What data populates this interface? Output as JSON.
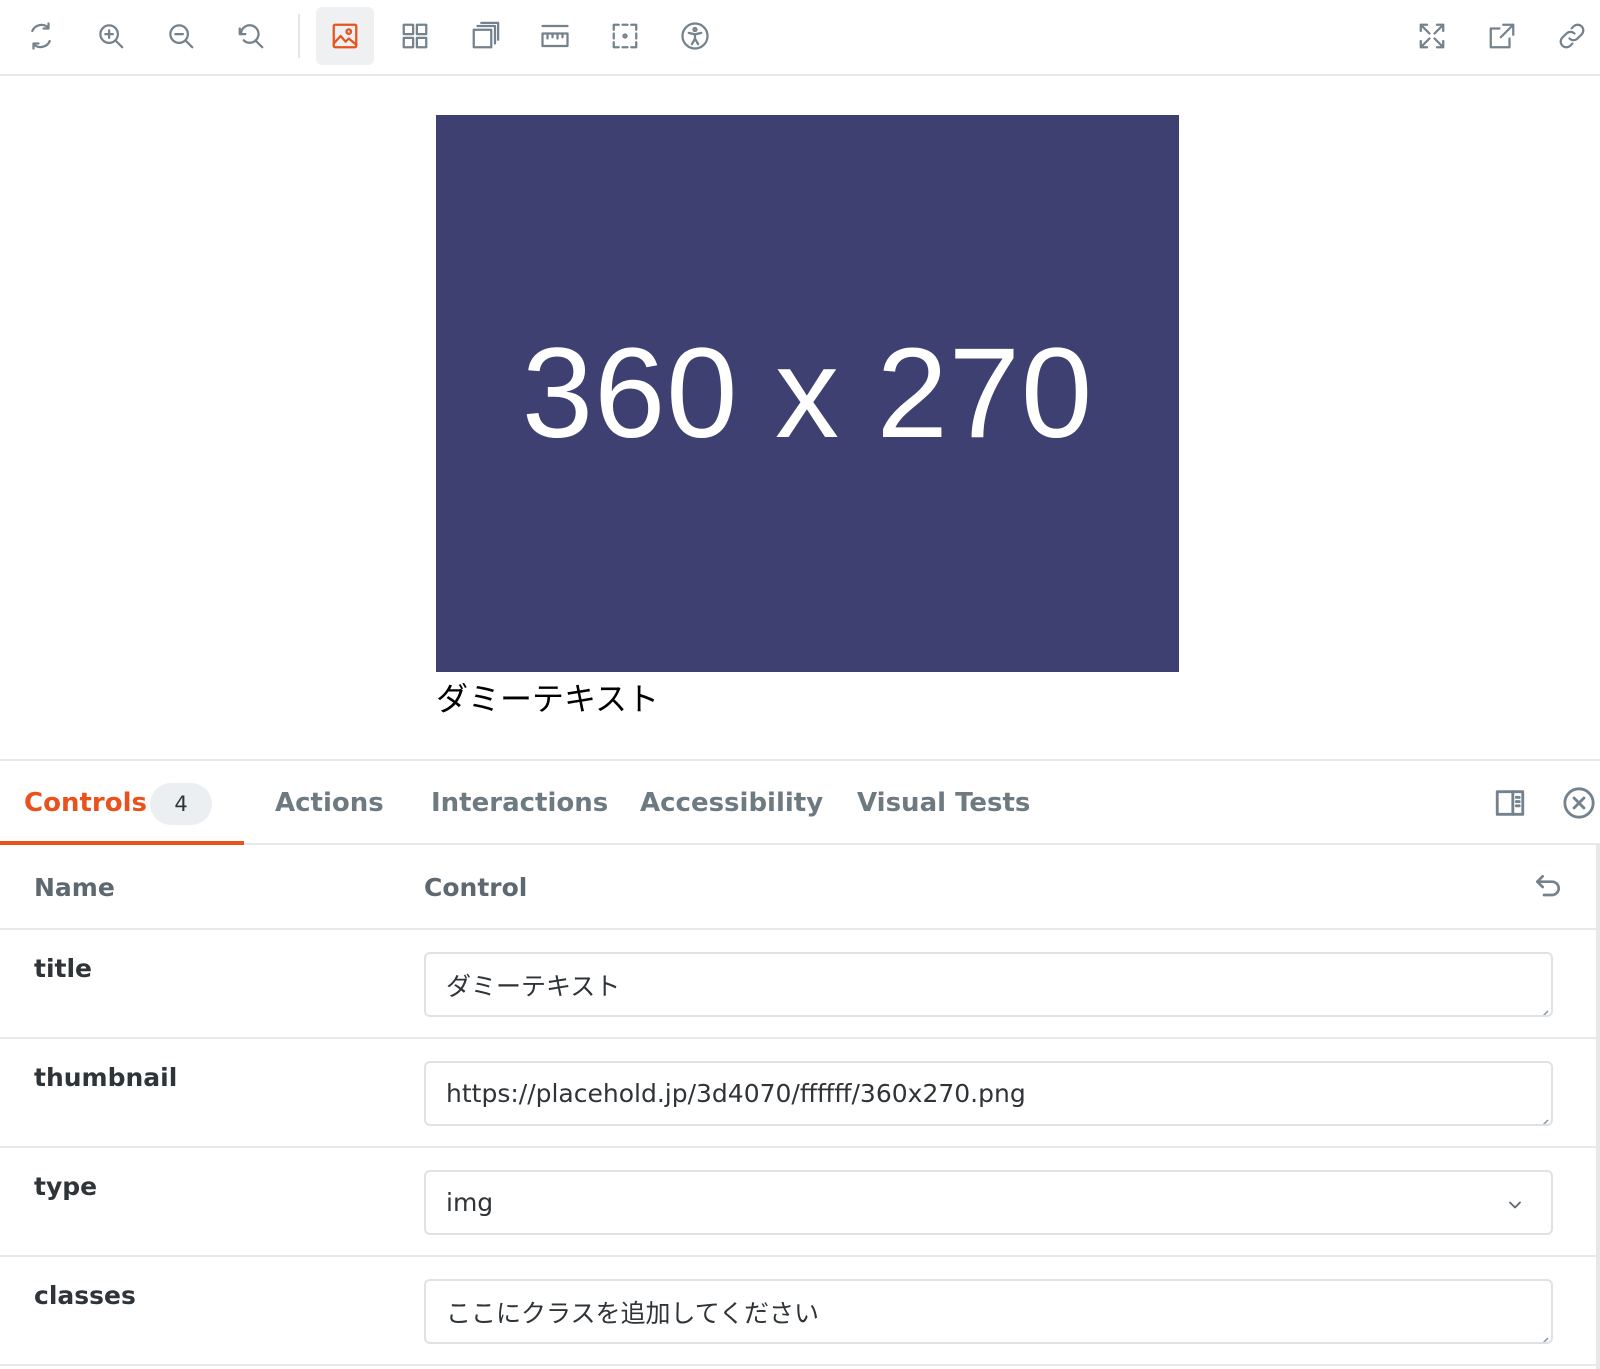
{
  "toolbar": {
    "active_tool": "background-image-icon"
  },
  "preview": {
    "thumbnail_bg": "#3d4070",
    "thumbnail_fg": "#ffffff",
    "thumbnail_text": "360 x 270",
    "caption": "ダミーテキスト"
  },
  "panel": {
    "accent": "#e9521d",
    "tabs": [
      {
        "label": "Controls",
        "badge": "4"
      },
      {
        "label": "Actions"
      },
      {
        "label": "Interactions"
      },
      {
        "label": "Accessibility"
      },
      {
        "label": "Visual Tests"
      }
    ],
    "table": {
      "header_name": "Name",
      "header_control": "Control",
      "rows": [
        {
          "name": "title",
          "value": "ダミーテキスト",
          "control": "textarea"
        },
        {
          "name": "thumbnail",
          "value": "https://placehold.jp/3d4070/ffffff/360x270.png",
          "control": "textarea"
        },
        {
          "name": "type",
          "value": "img",
          "control": "select"
        },
        {
          "name": "classes",
          "value": "ここにクラスを追加してください",
          "control": "textarea"
        }
      ]
    }
  }
}
